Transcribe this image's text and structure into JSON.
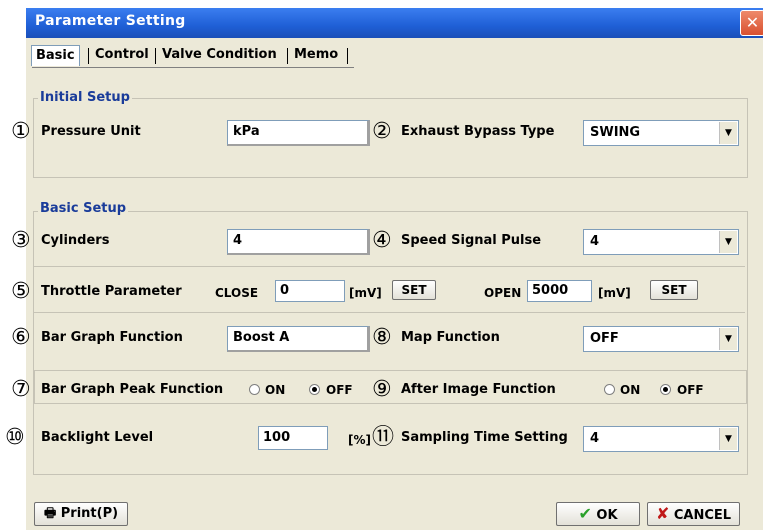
{
  "window": {
    "title": "Parameter Setting"
  },
  "tabs": [
    {
      "label": "Basic",
      "active": true
    },
    {
      "label": "Control",
      "active": false
    },
    {
      "label": "Valve Condition",
      "active": false
    },
    {
      "label": "Memo",
      "active": false
    }
  ],
  "initial_setup": {
    "title": "Initial Setup",
    "pressure_unit": {
      "num": "①",
      "label": "Pressure Unit",
      "value": "kPa"
    },
    "exhaust_bypass": {
      "num": "②",
      "label": "Exhaust Bypass Type",
      "value": "SWING"
    }
  },
  "basic_setup": {
    "title": "Basic Setup",
    "cylinders": {
      "num": "③",
      "label": "Cylinders",
      "value": "4"
    },
    "speed_signal": {
      "num": "④",
      "label": "Speed Signal Pulse",
      "value": "4"
    },
    "throttle": {
      "num": "⑤",
      "label": "Throttle Parameter",
      "close_label": "CLOSE",
      "close_value": "0",
      "close_unit": "[mV]",
      "close_set": "SET",
      "open_label": "OPEN",
      "open_value": "5000",
      "open_unit": "[mV]",
      "open_set": "SET"
    },
    "bar_graph": {
      "num": "⑥",
      "label": "Bar Graph Function",
      "value": "Boost A"
    },
    "map_function": {
      "num": "⑧",
      "label": "Map Function",
      "value": "OFF"
    },
    "bar_peak": {
      "num": "⑦",
      "label": "Bar Graph Peak Function",
      "on_label": "ON",
      "off_label": "OFF",
      "selected": "OFF"
    },
    "after_image": {
      "num": "⑨",
      "label": "After Image Function",
      "on_label": "ON",
      "off_label": "OFF",
      "selected": "OFF"
    },
    "backlight": {
      "num": "⑩",
      "label": "Backlight Level",
      "value": "100",
      "unit": "[%]"
    },
    "sampling": {
      "num": "⑪",
      "label": "Sampling Time Setting",
      "value": "4"
    }
  },
  "footer": {
    "print_label": "Print(P)",
    "ok_label": "OK",
    "cancel_label": "CANCEL"
  },
  "colors": {
    "titlebar": "#1f5fd6",
    "dialog_bg": "#ece9d8",
    "group_title": "#1a3c9a",
    "ok_check": "#2aa02a",
    "cancel_x": "#c01818"
  },
  "icons": {
    "close": "close-icon",
    "printer": "printer-icon",
    "check": "check-icon",
    "cancel": "x-icon",
    "dropdown": "chevron-down-icon"
  }
}
